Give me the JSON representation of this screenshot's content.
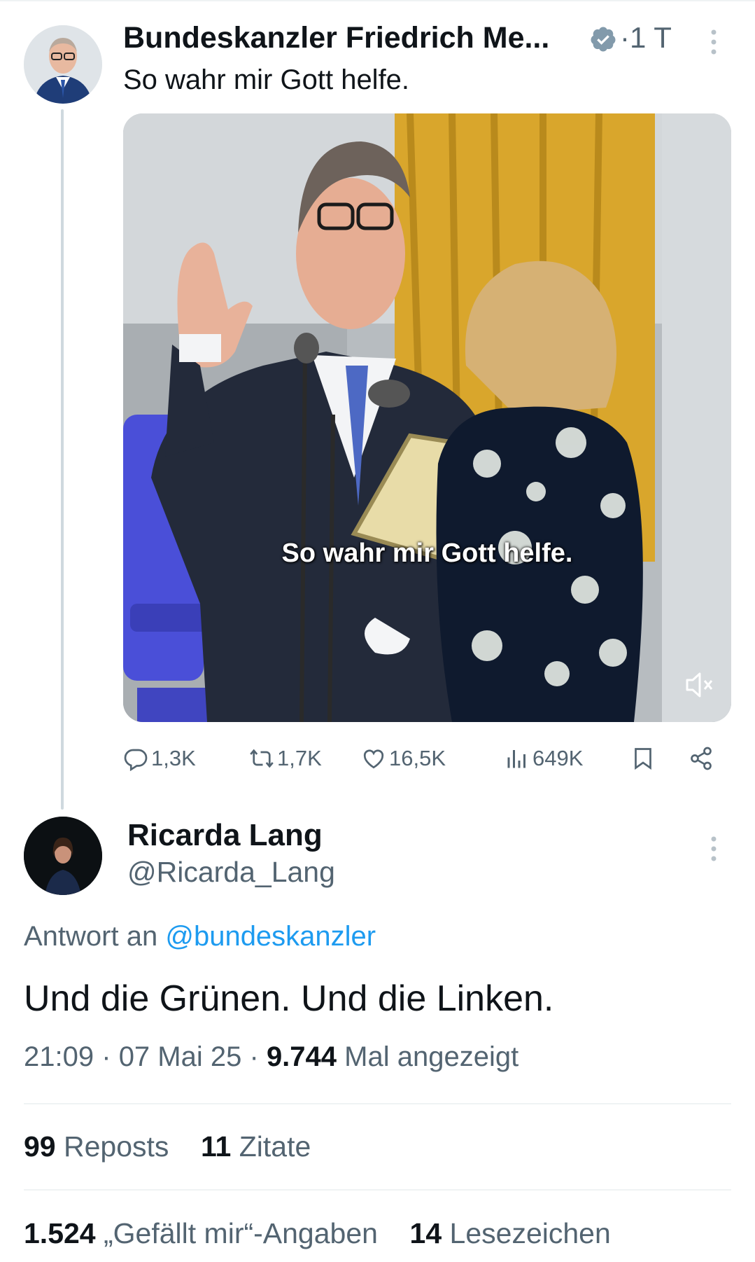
{
  "parent_tweet": {
    "author_name": "Bundeskanzler Friedrich Me...",
    "verified_icon": "verified-badge-icon",
    "time_separator": "·",
    "time": "1 T",
    "text": "So wahr mir Gott helfe.",
    "video_caption": "So wahr mir Gott helfe.",
    "actions": {
      "replies": "1,3K",
      "reposts": "1,7K",
      "likes": "16,5K",
      "views": "649K"
    }
  },
  "reply_tweet": {
    "author_name": "Ricarda Lang",
    "handle": "@Ricarda_Lang",
    "reply_prefix": "Antwort an",
    "reply_to_mention": "@bundeskanzler",
    "text": "Und die Grünen. Und die Linken.",
    "time": "21:09",
    "separator": "·",
    "date": "07 Mai 25",
    "views_count": "9.744",
    "views_label": "Mal angezeigt",
    "reposts_count": "99",
    "reposts_label": "Reposts",
    "quotes_count": "11",
    "quotes_label": "Zitate",
    "likes_count": "1.524",
    "likes_label": "„Gefällt mir“-Angaben",
    "bookmarks_count": "14",
    "bookmarks_label": "Lesezeichen"
  },
  "colors": {
    "text_primary": "#0f1419",
    "text_secondary": "#536471",
    "link": "#1d9bf0",
    "verified": "#829aab",
    "divider": "#eff3f4"
  }
}
